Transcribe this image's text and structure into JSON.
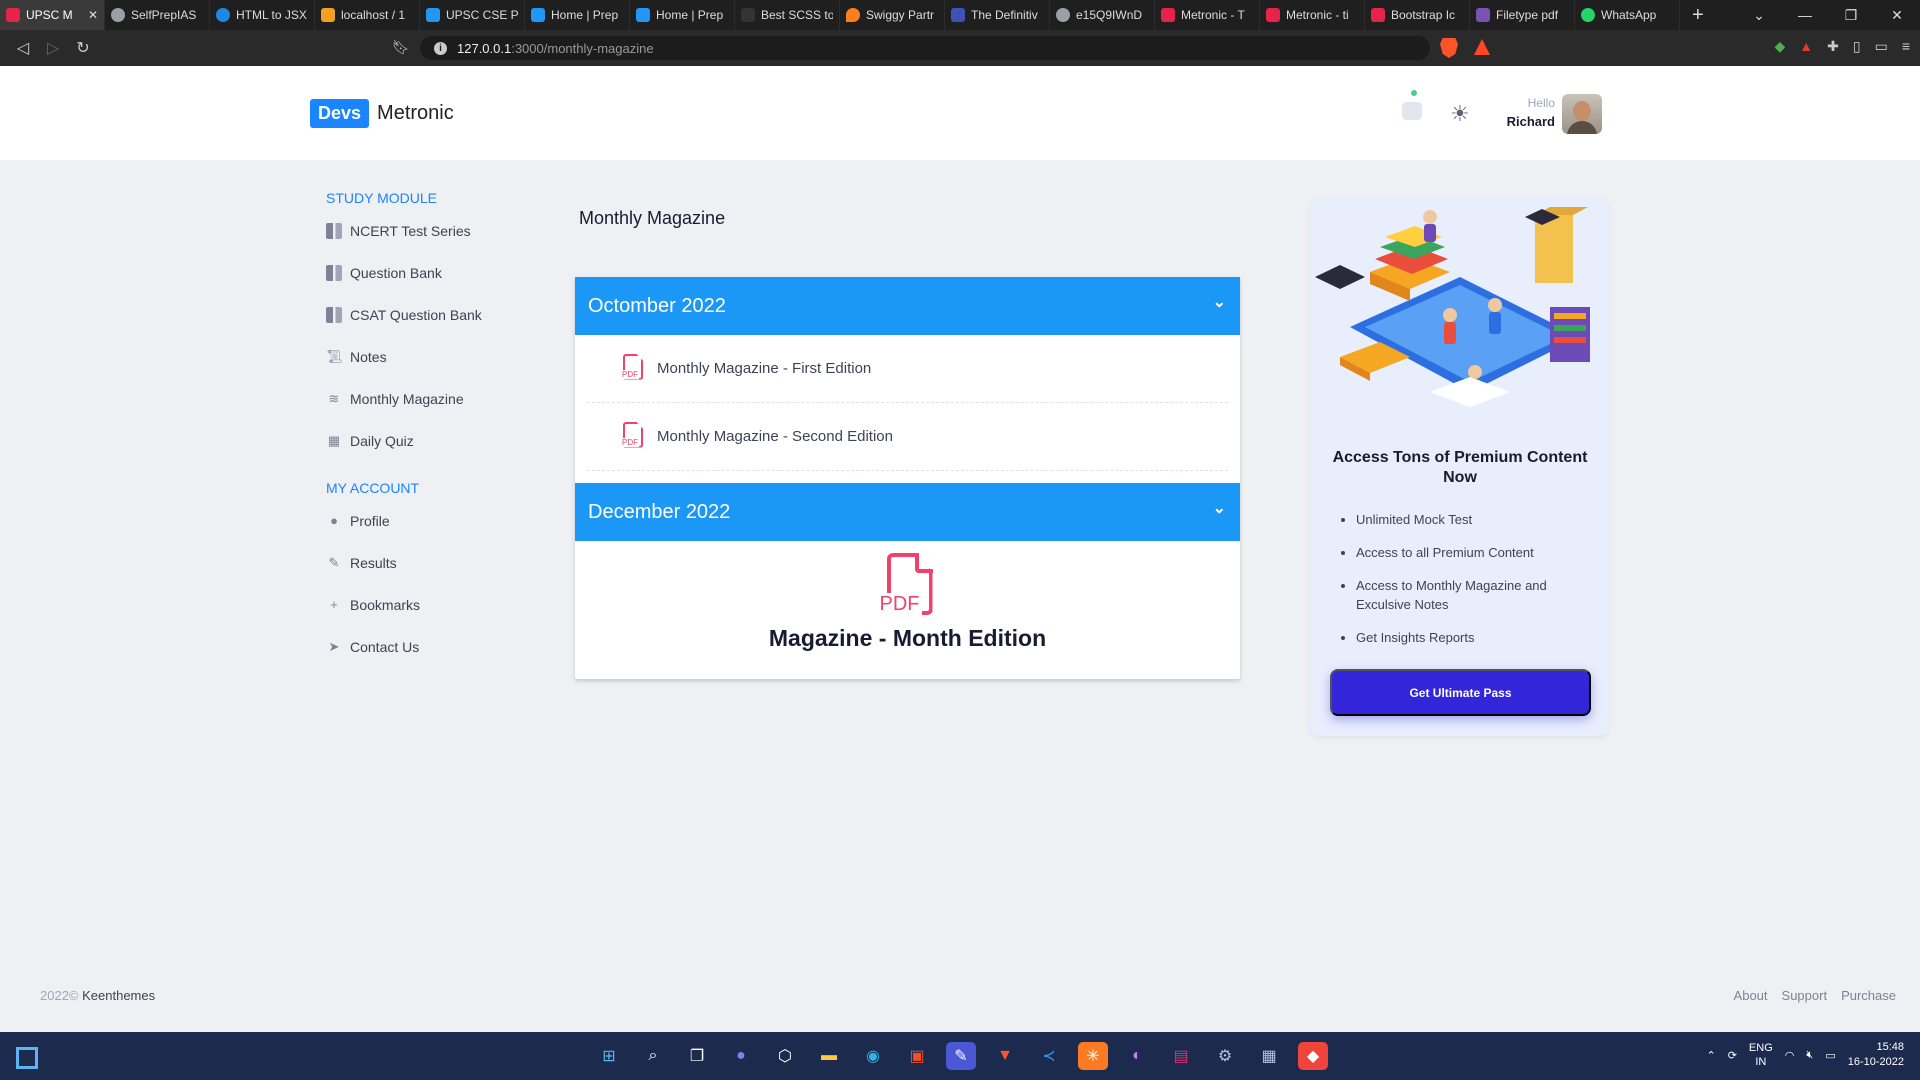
{
  "browser": {
    "tabs": [
      {
        "title": "UPSC M",
        "color": "#e8234a",
        "active": true
      },
      {
        "title": "SelfPrepIAS",
        "color": "#9aa0a6"
      },
      {
        "title": "HTML to JSX",
        "color": "#1e88e5"
      },
      {
        "title": "localhost / 1",
        "color": "#f4a020"
      },
      {
        "title": "UPSC CSE P",
        "color": "#2196f3"
      },
      {
        "title": "Home | Prep",
        "color": "#2196f3"
      },
      {
        "title": "Home | Prep",
        "color": "#2196f3"
      },
      {
        "title": "Best SCSS to",
        "color": "#333333"
      },
      {
        "title": "Swiggy Partr",
        "color": "#fc8019"
      },
      {
        "title": "The Definitiv",
        "color": "#3f51b5"
      },
      {
        "title": "e15Q9IWnD",
        "color": "#9aa0a6"
      },
      {
        "title": "Metronic - T",
        "color": "#e8234a"
      },
      {
        "title": "Metronic - ti",
        "color": "#e8234a"
      },
      {
        "title": "Bootstrap Ic",
        "color": "#e8234a"
      },
      {
        "title": "Filetype pdf",
        "color": "#7952b3"
      },
      {
        "title": "WhatsApp",
        "color": "#25d366"
      }
    ],
    "close_tab": "✕",
    "new_tab": "+",
    "url_host": "127.0.0.1",
    "url_path": ":3000/monthly-magazine",
    "window_controls": [
      "⌄",
      "—",
      "❐",
      "✕"
    ]
  },
  "header": {
    "logo_badge": "Devs",
    "logo_text_a": "Metro",
    "logo_text_b": "nic",
    "greeting": "Hello",
    "user_name": "Richard"
  },
  "sidebar": {
    "study_title": "STUDY MODULE",
    "study_items": [
      {
        "label": "NCERT Test Series",
        "icon": "book-icon"
      },
      {
        "label": "Question Bank",
        "icon": "book-icon"
      },
      {
        "label": "CSAT Question Bank",
        "icon": "book-icon"
      },
      {
        "label": "Notes",
        "icon": "scroll-icon"
      },
      {
        "label": "Monthly Magazine",
        "icon": "layers-icon"
      },
      {
        "label": "Daily Quiz",
        "icon": "calendar-icon"
      }
    ],
    "account_title": "MY ACCOUNT",
    "account_items": [
      {
        "label": "Profile",
        "icon": "person-icon"
      },
      {
        "label": "Results",
        "icon": "edit-icon"
      },
      {
        "label": "Bookmarks",
        "icon": "plus-icon"
      },
      {
        "label": "Contact Us",
        "icon": "send-icon"
      }
    ]
  },
  "main": {
    "title": "Monthly Magazine",
    "sections": [
      {
        "label": "Octomber 2022",
        "files": [
          "Monthly Magazine - First Edition",
          "Monthly Magazine - Second Edition"
        ]
      },
      {
        "label": "December 2022",
        "pdf_label": "PDF",
        "edition_title": "Magazine - Month Edition"
      }
    ],
    "pdf_small_label": "PDF"
  },
  "promo": {
    "title": "Access Tons of Premium Content Now",
    "features": [
      "Unlimited Mock Test",
      "Access to all Premium Content",
      "Access to Monthly Magazine and Exculsive Notes",
      "Get Insights Reports"
    ],
    "cta_label": "Get Ultimate Pass"
  },
  "footer": {
    "year": "2022©",
    "brand": "Keenthemes",
    "links": [
      "About",
      "Support",
      "Purchase"
    ]
  },
  "taskbar": {
    "lang_top": "ENG",
    "lang_bottom": "IN",
    "time": "15:48",
    "date": "16-10-2022"
  },
  "colors": {
    "accent": "#1b84ff",
    "accordion_header": "#1b98f5",
    "pdf_red": "#f1416c",
    "cta": "#3325d8"
  }
}
